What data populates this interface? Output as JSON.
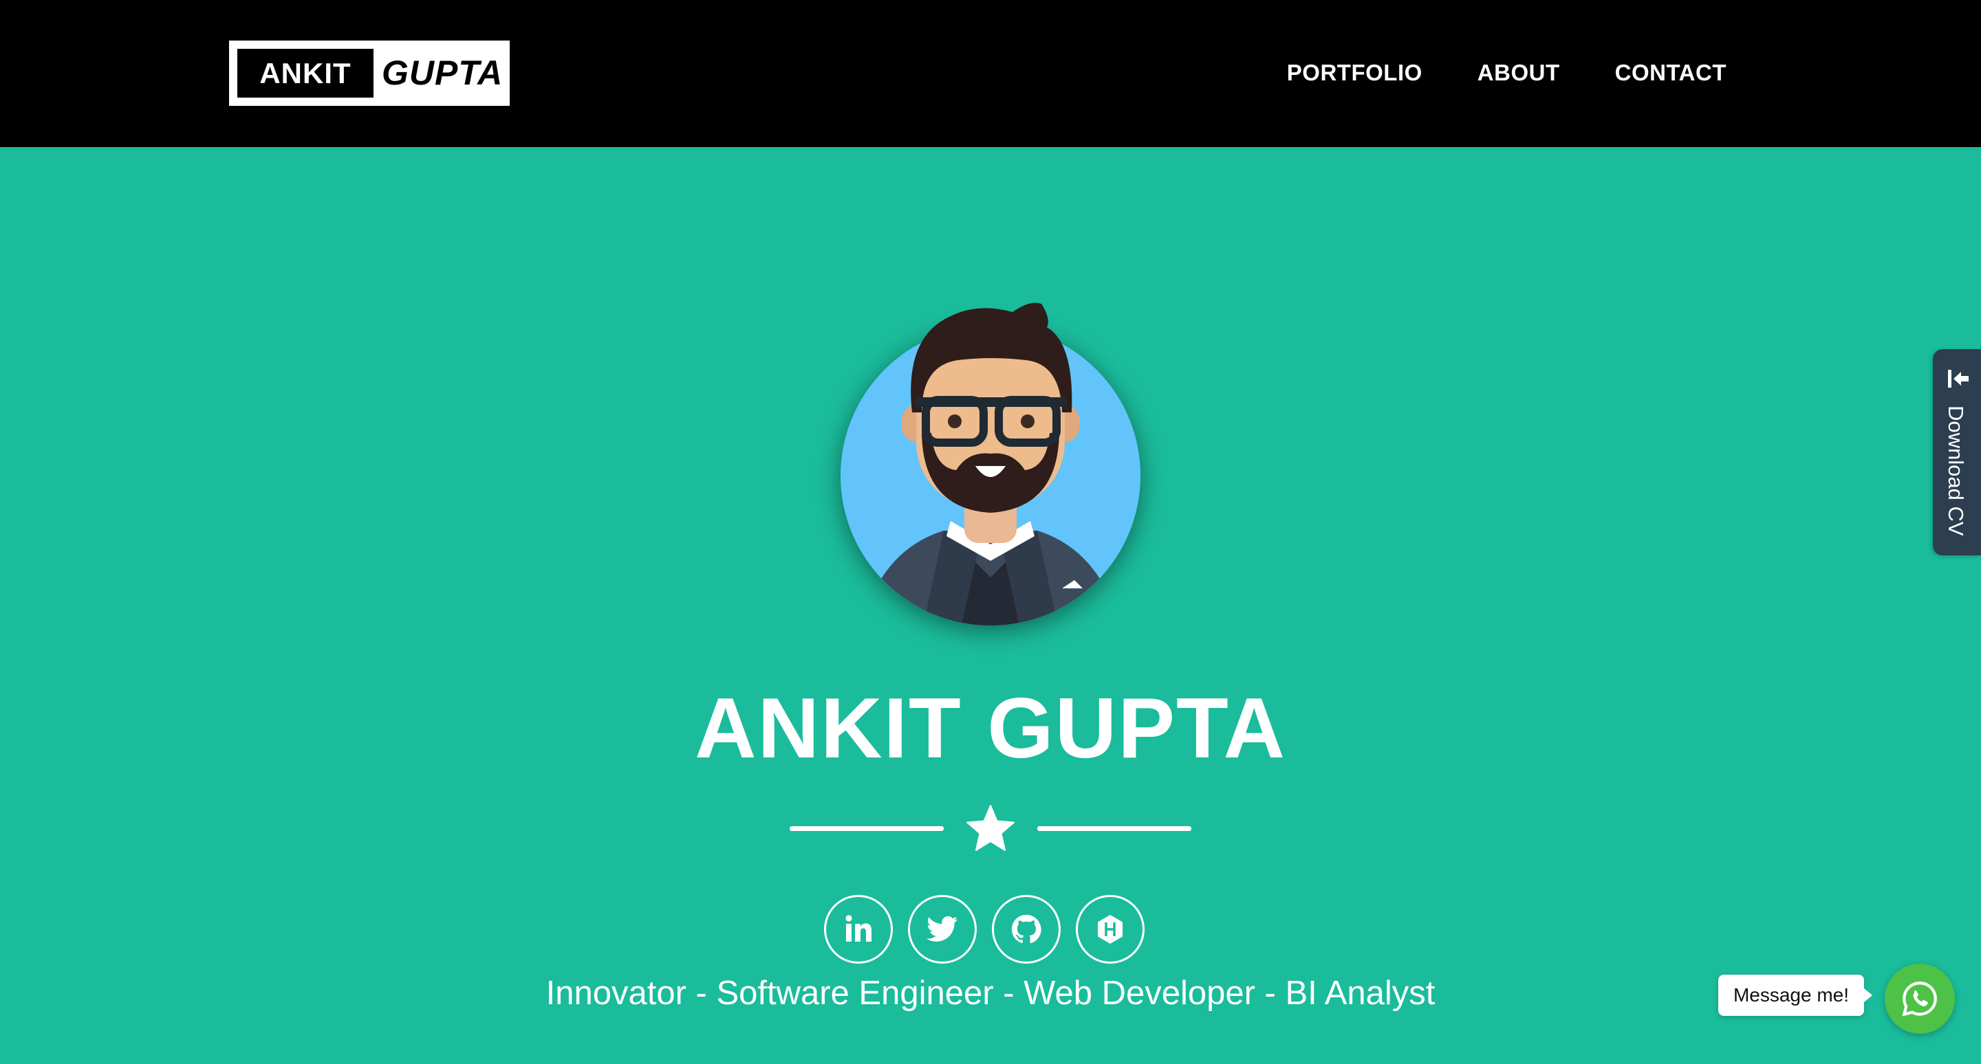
{
  "brand": {
    "first": "ANKIT",
    "last": "GUPTA"
  },
  "nav": {
    "items": [
      {
        "label": "PORTFOLIO"
      },
      {
        "label": "ABOUT"
      },
      {
        "label": "CONTACT"
      }
    ]
  },
  "hero": {
    "name": "ANKIT GUPTA",
    "divider_icon": "star-icon",
    "tagline": "Innovator - Software Engineer - Web Developer - BI Analyst",
    "avatar_icon": "avatar-illustration"
  },
  "socials": [
    {
      "name": "linkedin",
      "icon": "linkedin-icon"
    },
    {
      "name": "twitter",
      "icon": "twitter-icon"
    },
    {
      "name": "github",
      "icon": "github-icon"
    },
    {
      "name": "hackerrank",
      "icon": "hackerrank-icon"
    }
  ],
  "download_cv": {
    "label": "Download CV",
    "icon": "download-arrow-icon"
  },
  "whatsapp": {
    "bubble_text": "Message me!",
    "icon": "whatsapp-icon"
  },
  "colors": {
    "hero_bg": "#1abc9c",
    "navbar_bg": "#000000",
    "cv_tab_bg": "#2c3e50",
    "whatsapp_green": "#4dc247",
    "text": "#ffffff"
  }
}
